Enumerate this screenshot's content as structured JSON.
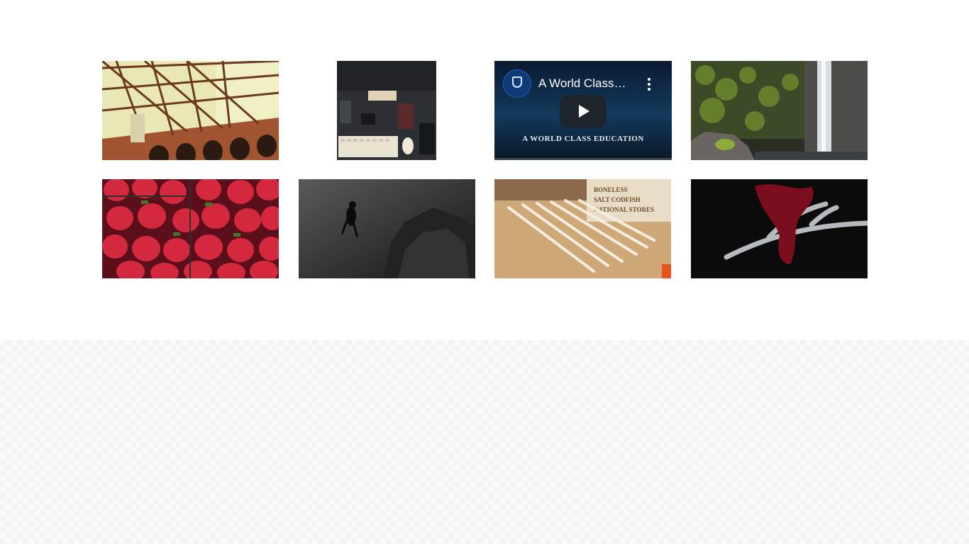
{
  "gallery": {
    "items": [
      {
        "type": "image",
        "subject": "bridge-steel-structure"
      },
      {
        "type": "image",
        "subject": "desk-workspace-flatlay"
      },
      {
        "type": "video",
        "title": "A World Class…",
        "caption": "A WORLD CLASS EDUCATION",
        "channel_icon": "university-crest-icon",
        "menu_icon": "kebab-menu-icon",
        "play_icon": "play-icon"
      },
      {
        "type": "image",
        "subject": "waterfall-mossy-cliff"
      },
      {
        "type": "image",
        "subject": "strawberries"
      },
      {
        "type": "image",
        "subject": "scuba-diver-underwater"
      },
      {
        "type": "image",
        "subject": "pencils-on-wooden-table"
      },
      {
        "type": "image",
        "subject": "antler-with-red-ribbon"
      }
    ]
  },
  "colors": {
    "background": "#ffffff",
    "pattern_background": "#fafafa",
    "video_bg": "#0b1a33"
  }
}
